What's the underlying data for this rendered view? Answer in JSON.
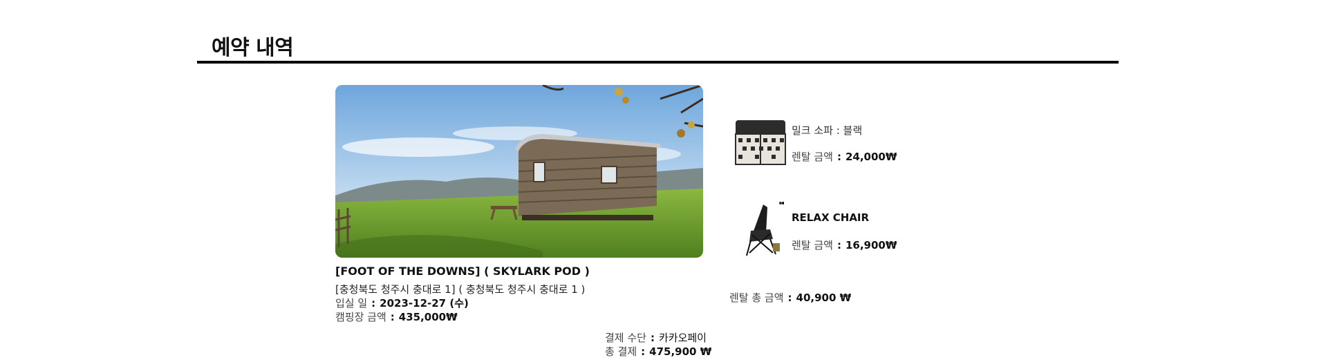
{
  "page": {
    "title": "예약 내역"
  },
  "reservation": {
    "site_name": "[FOOT OF THE DOWNS] ( SKYLARK POD )",
    "address": "[충청북도 청주시 충대로 1] ( 충청북도 청주시 충대로 1 )",
    "checkin_label": "입실 일",
    "checkin_value": "2023-12-27 (수)",
    "camp_price_label": "캠핑장 금액",
    "camp_price_value": "435,000₩",
    "separator": ":"
  },
  "rentals": {
    "items": [
      {
        "name": "밀크 소파 : 블랙",
        "price_label": "렌탈 금액",
        "price_value": "24,000₩",
        "icon": "milk-crate-sofa"
      },
      {
        "name": "RELAX CHAIR",
        "price_label": "렌탈 금액",
        "price_value": "16,900₩",
        "icon": "folding-chair"
      }
    ],
    "total_label": "렌탈 총 금액",
    "total_value": "40,900 ₩"
  },
  "payment": {
    "method_label": "결제 수단",
    "method_value": "카카오페이",
    "total_label": "총 결제",
    "total_value": "475,900 ₩"
  },
  "colors": {
    "rule": "#000000",
    "text": "#222222",
    "sky": "#a9cbe8",
    "grass": "#6f9a2c"
  }
}
